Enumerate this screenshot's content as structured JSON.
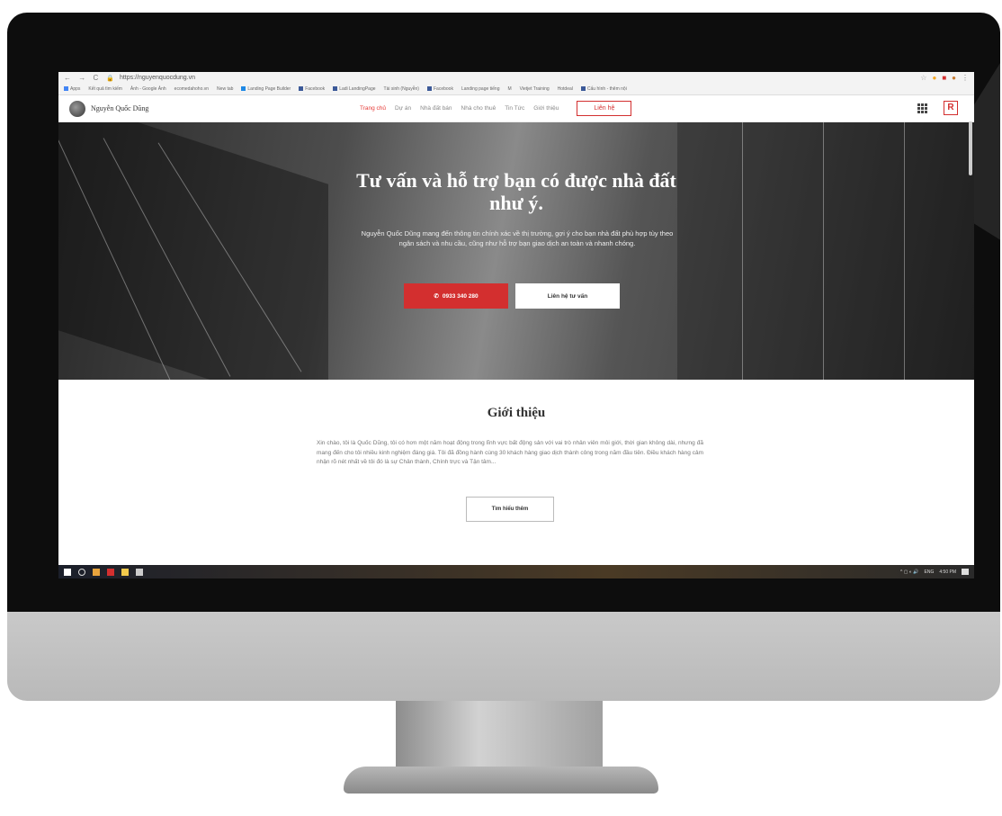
{
  "browser": {
    "url": "https://nguyenquocdung.vn",
    "bookmarks": [
      "Apps",
      "Kết quả tìm kiếm",
      "Ảnh - Google Ảnh",
      "ecomedahoho.vn",
      "New tab",
      "Landing Page Builder",
      "Facebook",
      "Ladi LandingPage",
      "Tài sinh (Nguyễn)",
      "Facebook",
      "Landing page tiếng",
      "M",
      "Vietjet Training",
      "Hotdeal",
      "Cấu hình - thêm nội"
    ]
  },
  "site": {
    "brand_name": "Nguyễn Quốc Dũng",
    "nav": [
      "Trang chủ",
      "Dự án",
      "Nhà đất bán",
      "Nhà cho thuê",
      "Tin Tức",
      "Giới thiệu"
    ],
    "cta": "Liên hệ",
    "r_logo": "R"
  },
  "hero": {
    "title_line1": "Tư vấn và hỗ trợ bạn có được nhà đất",
    "title_line2": "như ý.",
    "description": "Nguyễn Quốc Dũng mang đến thông tin chính xác về thị trường, gợi ý cho bạn nhà đất phù hợp tùy theo ngân sách và nhu cầu, cũng như hỗ trợ bạn giao dịch an toàn và nhanh chóng.",
    "phone_button": "0933 340 280",
    "consult_button": "Liên hệ tư vấn"
  },
  "intro": {
    "title": "Giới thiệu",
    "text": "Xin chào, tôi là Quốc Dũng, tôi có hơn một năm hoạt động trong lĩnh vực bất động sản với vai trò nhân viên môi giới, thời gian không dài, nhưng đã mang đến cho tôi nhiều kinh nghiệm đáng giá. Tôi đã đồng hành cùng 30 khách hàng giao dịch thành công trong năm đầu tiên. Điều khách hàng cảm nhận rõ nét nhất về tôi đó là sự Chân thành, Chính trực và Tận tâm...",
    "button": "Tìm hiểu thêm"
  },
  "taskbar": {
    "tray_lang": "ENG",
    "tray_time": "4:50 PM"
  },
  "colors": {
    "accent": "#d32f2f"
  }
}
